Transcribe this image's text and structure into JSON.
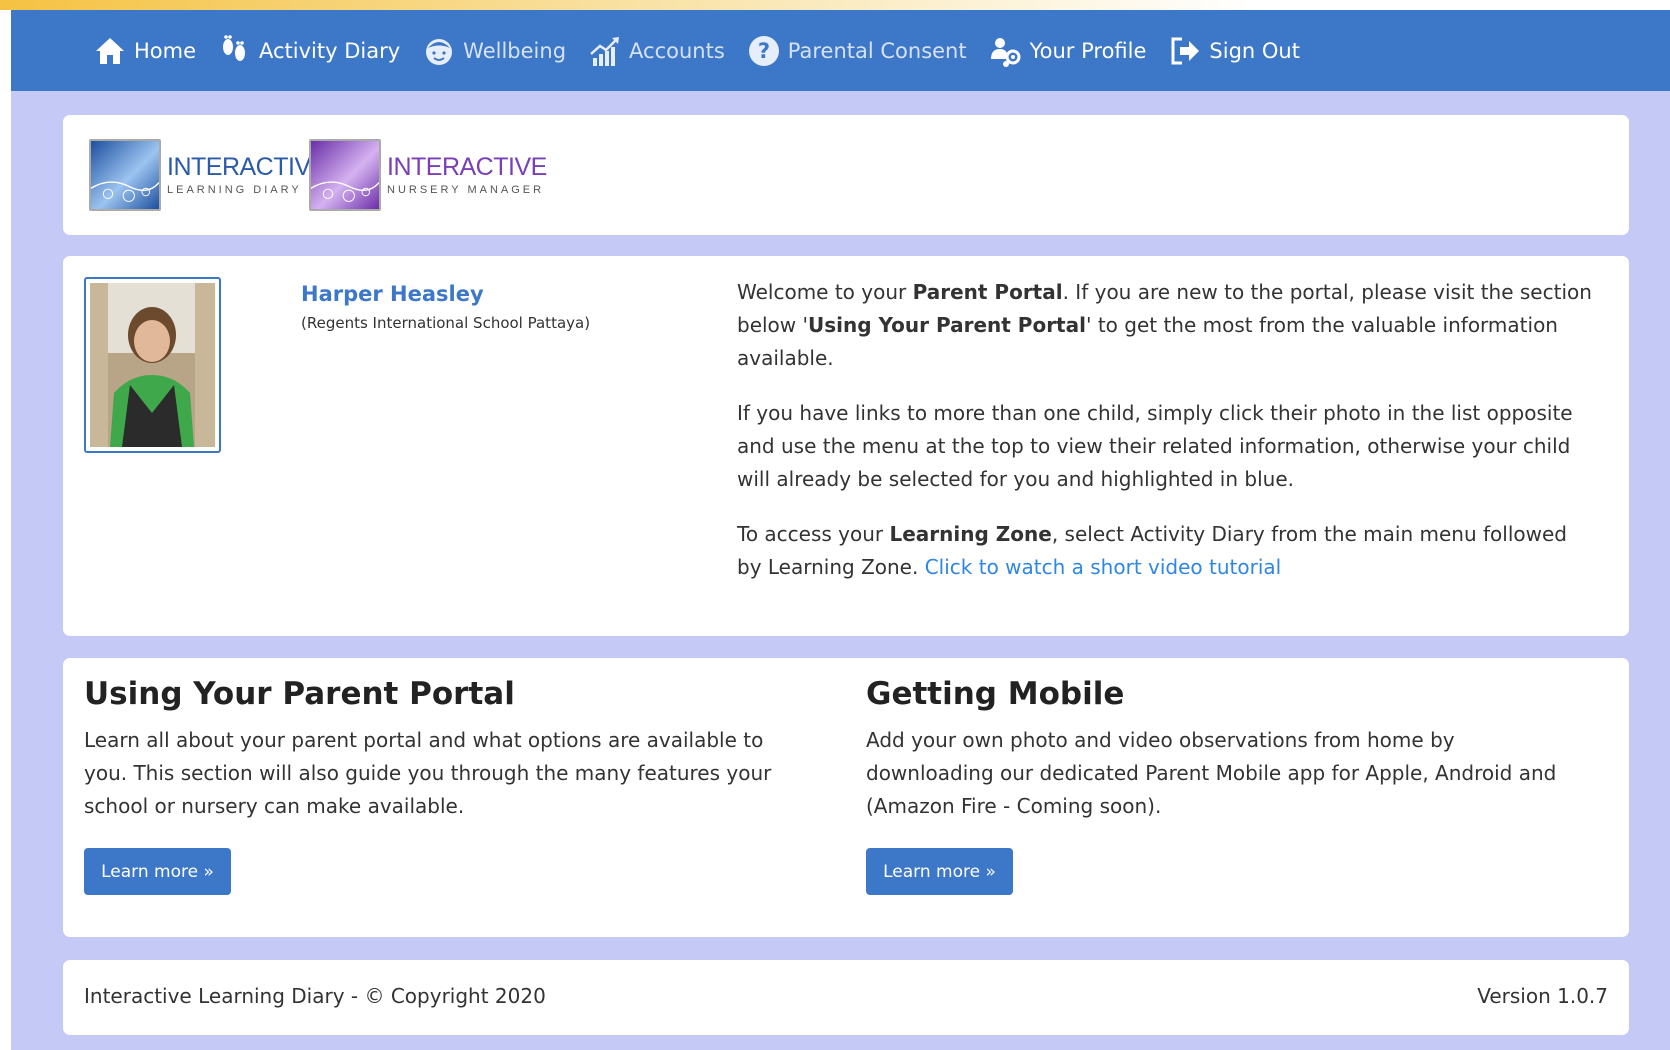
{
  "nav": {
    "items": [
      {
        "label": "Home",
        "icon": "home-icon",
        "state": "active"
      },
      {
        "label": "Activity Diary",
        "icon": "footprints-icon",
        "state": "active"
      },
      {
        "label": "Wellbeing",
        "icon": "child-face-icon",
        "state": "dim"
      },
      {
        "label": "Accounts",
        "icon": "chart-up-icon",
        "state": "dim"
      },
      {
        "label": "Parental Consent",
        "icon": "question-circle-icon",
        "state": "dim"
      },
      {
        "label": "Your Profile",
        "icon": "users-gear-icon",
        "state": "active"
      },
      {
        "label": "Sign Out",
        "icon": "sign-out-icon",
        "state": "active"
      }
    ]
  },
  "logos": [
    {
      "word": "INTERACTIVE",
      "sub": "LEARNING DIARY",
      "color": "#2b5ba8"
    },
    {
      "word": "INTERACTIVE",
      "sub": "NURSERY MANAGER",
      "color": "#7a3fb8"
    }
  ],
  "child": {
    "name": "Harper Heasley",
    "school": "(Regents International School Pattaya)"
  },
  "welcome": {
    "p1_a": "Welcome to your ",
    "p1_b": "Parent Portal",
    "p1_c": ". If you are new to the portal, please visit the section below '",
    "p1_d": "Using Your Parent Portal",
    "p1_e": "' to get the most from the valuable information available.",
    "p2": "If you have links to more than one child, simply click their photo in the list opposite and use the menu at the top to view their related information, otherwise your child will already be selected for you and highlighted in blue.",
    "p3_a": "To access your ",
    "p3_b": "Learning Zone",
    "p3_c": ", select Activity Diary from the main menu followed by Learning Zone. ",
    "p3_link": "Click to watch a short video tutorial"
  },
  "sections": [
    {
      "title": "Using Your Parent Portal",
      "body": "Learn all about your parent portal and what options are available to you. This section will also guide you through the many features your school or nursery can make available.",
      "button": "Learn more »"
    },
    {
      "title": "Getting Mobile",
      "body": "Add your own photo and video observations from home by downloading our dedicated Parent Mobile app for Apple, Android and (Amazon Fire - Coming soon).",
      "button": "Learn more »"
    }
  ],
  "footer": {
    "copyright": "Interactive Learning Diary - © Copyright 2020",
    "version": "Version 1.0.7"
  },
  "colors": {
    "nav_bg": "#3d77c8",
    "page_bg": "#c5c9f5",
    "link": "#2f86e4",
    "accent_purple": "#7a3fb8"
  }
}
